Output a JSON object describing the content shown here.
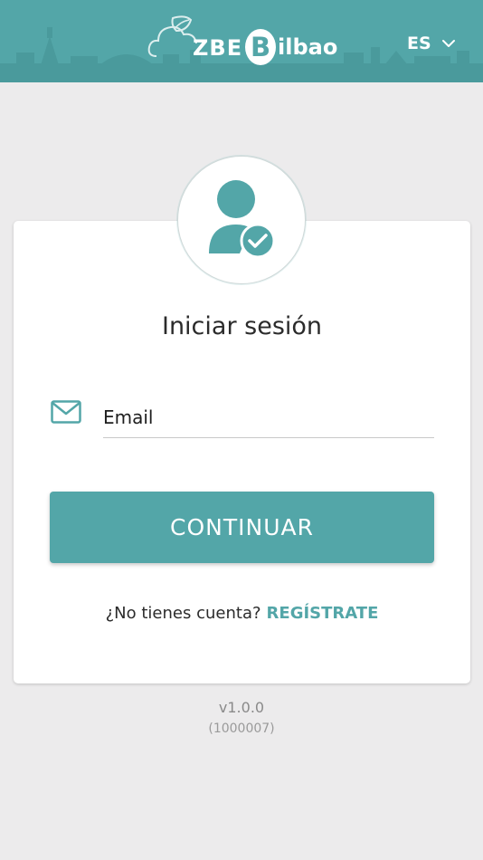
{
  "header": {
    "logo": {
      "part1": "ZBE",
      "initial": "B",
      "part2": "ilbao"
    },
    "language": {
      "selected": "ES",
      "icon": "chevron-down-icon"
    }
  },
  "login": {
    "avatar_icon": "user-check-icon",
    "title": "Iniciar sesión",
    "email": {
      "icon": "envelope-icon",
      "placeholder": "Email",
      "value": ""
    },
    "continue_label": "CONTINUAR",
    "signup_prompt": "¿No tienes cuenta?",
    "signup_link": "REGÍSTRATE"
  },
  "footer": {
    "version": "v1.0.0",
    "build": "(1000007)"
  },
  "colors": {
    "accent": "#53a6a8",
    "background": "#ecebec",
    "card": "#ffffff",
    "text": "#2b2b2b"
  }
}
